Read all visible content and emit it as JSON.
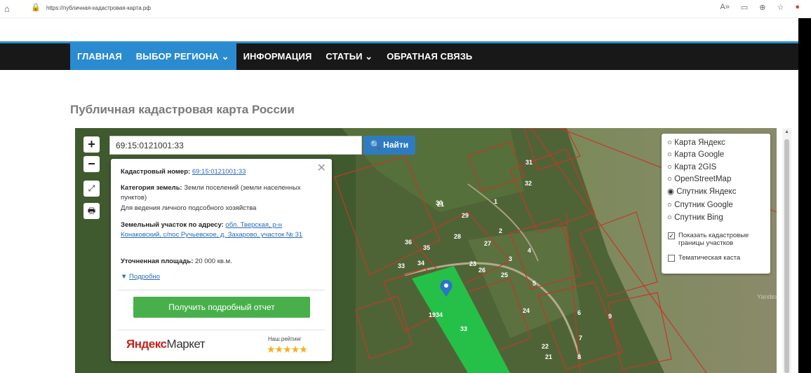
{
  "browser": {
    "url": "https://публичная-кадастровая-карта.рф",
    "home_icon": "home-icon",
    "lock_icon": "lock-icon",
    "toolbar_icons": [
      "read-aloud-icon",
      "immersive-reader-icon",
      "zoom-icon",
      "favorites-icon",
      "extension-icon"
    ]
  },
  "nav": {
    "items": [
      {
        "label": "ГЛАВНАЯ"
      },
      {
        "label": "ВЫБОР РЕГИОНА ⌄"
      },
      {
        "label": "ИНФОРМАЦИЯ"
      },
      {
        "label": "СТАТЬИ ⌄"
      },
      {
        "label": "ОБРАТНАЯ СВЯЗЬ"
      }
    ],
    "accent_color": "#2a8bd0",
    "bar_color": "#181818"
  },
  "page": {
    "title": "Публичная кадастровая карта России"
  },
  "map": {
    "zoom_in": "+",
    "zoom_out": "−",
    "fullscreen_icon": "fullscreen-icon",
    "print_icon": "print-icon",
    "search": {
      "value": "69:15:0121001:33",
      "button_label": "Найти"
    },
    "popup": {
      "cad_number_label": "Кадастровый номер:",
      "cad_number_value": "69:15:0121001:33",
      "category_label": "Категория земель:",
      "category_value": "Земли поселений (земли населенных пунктов)",
      "usage": "Для ведения личного подсобного хозяйства",
      "address_label": "Земельный участок по адресу:",
      "address_value": "обл. Тверская, р-н Конаковский, с/пос Ручьевское, д. Захарово, участок № 31",
      "area_label": "Уточненная площадь:",
      "area_value": "20 000 кв.м.",
      "more_link": "Подробно",
      "report_button": "Получить подробный отчет",
      "market_brand_red": "Яндекс",
      "market_brand_dark": "Маркет",
      "rating_label": "Наш рейтинг",
      "rating_stars": "★★★★★",
      "rating_value": 5
    },
    "layers": {
      "options": [
        {
          "label": "Карта Яндекс",
          "selected": false
        },
        {
          "label": "Карта Google",
          "selected": false
        },
        {
          "label": "Карта 2GIS",
          "selected": false
        },
        {
          "label": "OpenStreetMap",
          "selected": false
        },
        {
          "label": "Спутник Яндекс",
          "selected": true
        },
        {
          "label": "Спутник Google",
          "selected": false
        },
        {
          "label": "Спутник Bing",
          "selected": false
        }
      ],
      "checkboxes": [
        {
          "label": "Показать кадастровые границы участков",
          "checked": true
        },
        {
          "label": "Тематическая каста",
          "checked": false
        }
      ]
    },
    "parcel_labels": [
      "31",
      "32",
      "1",
      "29",
      "30",
      "28",
      "2",
      "3",
      "4",
      "27",
      "26",
      "25",
      "5",
      "23",
      "24",
      "22",
      "36",
      "35",
      "34",
      "33",
      "6",
      "7",
      "8",
      "9",
      "10",
      "21",
      "20",
      "26"
    ],
    "watermark": "Yandex",
    "highlight_color": "#22c84a"
  }
}
